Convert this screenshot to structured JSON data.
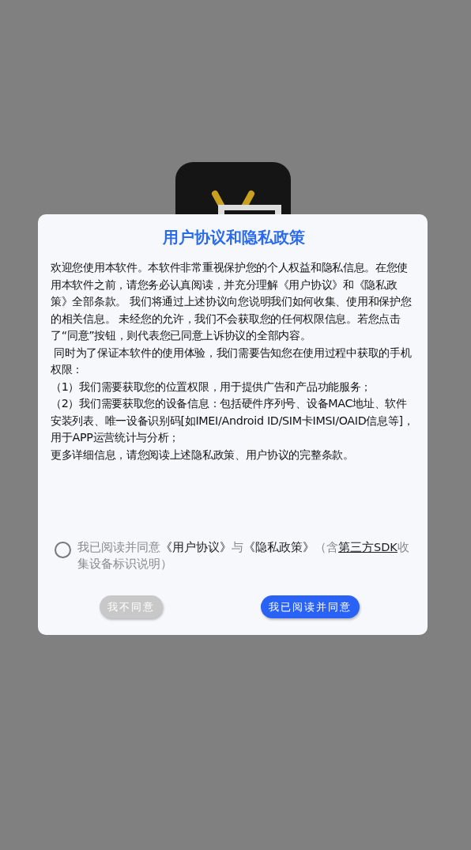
{
  "dialog": {
    "title": "用户协议和隐私政策",
    "paragraphs": [
      "欢迎您使用本软件。本软件非常重视保护您的个人权益和隐私信息。在您使用本软件之前，请您务必认真阅读，并充分理解《用户协议》和《隐私政策》全部条款。 我们将通过上述协议向您说明我们如何收集、使用和保护您的相关信息。 未经您的允许，我们不会获取您的任何权限信息。若您点击了“同意”按钮，则代表您已同意上诉协议的全部内容。",
      " 同时为了保证本软件的使用体验，我们需要告知您在使用过程中获取的手机权限：",
      "（1）我们需要获取您的位置权限，用于提供广告和产品功能服务；",
      "（2）我们需要获取您的设备信息：包括硬件序列号、设备MAC地址、软件安装列表、唯一设备识别码[如IMEI/Android ID/SIM卡IMSI/OAID信息等]，用于APP运营统计与分析；",
      "更多详细信息，请您阅读上述隐私政策、用户协议的完整条款。"
    ],
    "consent": {
      "checked": false,
      "parts": [
        {
          "kind": "text",
          "text": "我已阅读并同意"
        },
        {
          "kind": "link",
          "text": "《用户协议》"
        },
        {
          "kind": "text",
          "text": "与"
        },
        {
          "kind": "link",
          "text": "《隐私政策》"
        },
        {
          "kind": "text",
          "text": "（含"
        },
        {
          "kind": "underlined",
          "text": "第三方SDK"
        },
        {
          "kind": "text",
          "text": "收集设备标识说明）"
        }
      ]
    },
    "buttons": [
      {
        "label": "我不同意",
        "kind": "secondary"
      },
      {
        "label": "我已阅读并同意",
        "kind": "primary"
      }
    ]
  }
}
